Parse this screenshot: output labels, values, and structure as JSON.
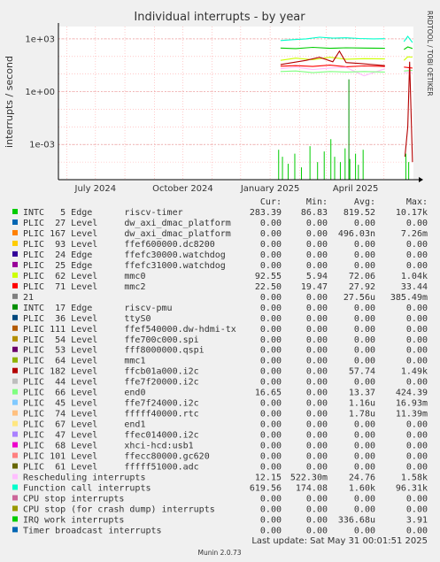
{
  "chart_data": {
    "type": "line",
    "title": "Individual interrupts - by year",
    "ylabel": "interrupts / second",
    "watermark": "RRDTOOL / TOBI OETIKER",
    "y_scale": "log",
    "ylim": [
      1e-05,
      5000
    ],
    "y_ticks": [
      {
        "value": 1000,
        "label": "1e+03"
      },
      {
        "value": 1,
        "label": "1e+00"
      },
      {
        "value": 0.001,
        "label": "1e-03"
      }
    ],
    "xlim": [
      "2024-05-23",
      "2025-06-01"
    ],
    "x_ticks": [
      {
        "date": "2024-07-01",
        "label": "July 2024"
      },
      {
        "date": "2024-10-01",
        "label": "October 2024"
      },
      {
        "date": "2025-01-01",
        "label": "January 2025"
      },
      {
        "date": "2025-04-01",
        "label": "April 2025"
      }
    ],
    "grid": true,
    "columns": [
      "Cur:",
      "Min:",
      "Avg:",
      "Max:"
    ],
    "series": [
      {
        "name": "INTC   5 Edge      riscv-timer",
        "color": "#00cc00",
        "cur": "283.39",
        "min": "86.83",
        "avg": "819.52",
        "max": "10.17k"
      },
      {
        "name": "PLIC  27 Level     dw_axi_dmac_platform",
        "color": "#0066b3",
        "cur": "0.00",
        "min": "0.00",
        "avg": "0.00",
        "max": "0.00"
      },
      {
        "name": "PLIC 167 Level     dw_axi_dmac_platform",
        "color": "#ff8000",
        "cur": "0.00",
        "min": "0.00",
        "avg": "496.03n",
        "max": "7.26m"
      },
      {
        "name": "PLIC  93 Level     ffef600000.dc8200",
        "color": "#ffcc00",
        "cur": "0.00",
        "min": "0.00",
        "avg": "0.00",
        "max": "0.00"
      },
      {
        "name": "PLIC  24 Edge      ffefc30000.watchdog",
        "color": "#330099",
        "cur": "0.00",
        "min": "0.00",
        "avg": "0.00",
        "max": "0.00"
      },
      {
        "name": "PLIC  25 Edge      ffefc31000.watchdog",
        "color": "#990099",
        "cur": "0.00",
        "min": "0.00",
        "avg": "0.00",
        "max": "0.00"
      },
      {
        "name": "PLIC  62 Level     mmc0",
        "color": "#ccff00",
        "cur": "92.55",
        "min": "5.94",
        "avg": "72.06",
        "max": "1.04k"
      },
      {
        "name": "PLIC  71 Level     mmc2",
        "color": "#ff0000",
        "cur": "22.50",
        "min": "19.47",
        "avg": "27.92",
        "max": "33.44"
      },
      {
        "name": "21",
        "color": "#808080",
        "cur": "0.00",
        "min": "0.00",
        "avg": "27.56u",
        "max": "385.49m"
      },
      {
        "name": "INTC  17 Edge      riscv-pmu",
        "color": "#008f00",
        "cur": "0.00",
        "min": "0.00",
        "avg": "0.00",
        "max": "0.00"
      },
      {
        "name": "PLIC  36 Level     ttyS0",
        "color": "#00487d",
        "cur": "0.00",
        "min": "0.00",
        "avg": "0.00",
        "max": "0.00"
      },
      {
        "name": "PLIC 111 Level     ffef540000.dw-hdmi-tx",
        "color": "#b35a00",
        "cur": "0.00",
        "min": "0.00",
        "avg": "0.00",
        "max": "0.00"
      },
      {
        "name": "PLIC  54 Level     ffe700c000.spi",
        "color": "#b38f00",
        "cur": "0.00",
        "min": "0.00",
        "avg": "0.00",
        "max": "0.00"
      },
      {
        "name": "PLIC  53 Level     fff8000000.qspi",
        "color": "#6b006b",
        "cur": "0.00",
        "min": "0.00",
        "avg": "0.00",
        "max": "0.00"
      },
      {
        "name": "PLIC  64 Level     mmc1",
        "color": "#8fb300",
        "cur": "0.00",
        "min": "0.00",
        "avg": "0.00",
        "max": "0.00"
      },
      {
        "name": "PLIC 182 Level     ffcb01a000.i2c",
        "color": "#b30000",
        "cur": "0.00",
        "min": "0.00",
        "avg": "57.74",
        "max": "1.49k"
      },
      {
        "name": "PLIC  44 Level     ffe7f20000.i2c",
        "color": "#bebebe",
        "cur": "0.00",
        "min": "0.00",
        "avg": "0.00",
        "max": "0.00"
      },
      {
        "name": "PLIC  66 Level     end0",
        "color": "#80ff80",
        "cur": "16.65",
        "min": "0.00",
        "avg": "13.37",
        "max": "424.39"
      },
      {
        "name": "PLIC  45 Level     ffe7f24000.i2c",
        "color": "#80c9ff",
        "cur": "0.00",
        "min": "0.00",
        "avg": "1.16u",
        "max": "16.93m"
      },
      {
        "name": "PLIC  74 Level     fffff40000.rtc",
        "color": "#ffc080",
        "cur": "0.00",
        "min": "0.00",
        "avg": "1.78u",
        "max": "11.39m"
      },
      {
        "name": "PLIC  67 Level     end1",
        "color": "#ffe680",
        "cur": "0.00",
        "min": "0.00",
        "avg": "0.00",
        "max": "0.00"
      },
      {
        "name": "PLIC  47 Level     ffec014000.i2c",
        "color": "#aa80ff",
        "cur": "0.00",
        "min": "0.00",
        "avg": "0.00",
        "max": "0.00"
      },
      {
        "name": "PLIC  68 Level     xhci-hcd:usb1",
        "color": "#ee00cc",
        "cur": "0.00",
        "min": "0.00",
        "avg": "0.00",
        "max": "0.00"
      },
      {
        "name": "PLIC 101 Level     ffecc80000.gc620",
        "color": "#ff8080",
        "cur": "0.00",
        "min": "0.00",
        "avg": "0.00",
        "max": "0.00"
      },
      {
        "name": "PLIC  61 Level     fffff51000.adc",
        "color": "#666600",
        "cur": "0.00",
        "min": "0.00",
        "avg": "0.00",
        "max": "0.00"
      },
      {
        "name": "Rescheduling interrupts",
        "color": "#ffbfff",
        "cur": "12.15",
        "min": "522.30m",
        "avg": "24.76",
        "max": "1.58k"
      },
      {
        "name": "Function call interrupts",
        "color": "#00ffcc",
        "cur": "619.56",
        "min": "174.08",
        "avg": "1.60k",
        "max": "96.31k"
      },
      {
        "name": "CPU stop interrupts",
        "color": "#cc6699",
        "cur": "0.00",
        "min": "0.00",
        "avg": "0.00",
        "max": "0.00"
      },
      {
        "name": "CPU stop (for crash dump) interrupts",
        "color": "#999900",
        "cur": "0.00",
        "min": "0.00",
        "avg": "0.00",
        "max": "0.00"
      },
      {
        "name": "IRQ work interrupts",
        "color": "#00cc00",
        "cur": "0.00",
        "min": "0.00",
        "avg": "336.68u",
        "max": "3.91"
      },
      {
        "name": "Timer broadcast interrupts",
        "color": "#0066b3",
        "cur": "0.00",
        "min": "0.00",
        "avg": "0.00",
        "max": "0.00"
      }
    ],
    "line_traces": [
      {
        "color": "#00ffcc",
        "segments": [
          [
            [
              "2025-01-12",
              800
            ],
            [
              "2025-01-25",
              900
            ],
            [
              "2025-02-08",
              1000
            ],
            [
              "2025-02-22",
              1250
            ],
            [
              "2025-03-08",
              1100
            ],
            [
              "2025-03-22",
              1150
            ],
            [
              "2025-04-05",
              1050
            ],
            [
              "2025-04-20",
              1000
            ],
            [
              "2025-05-02",
              1020
            ]
          ],
          [
            [
              "2025-05-22",
              700
            ],
            [
              "2025-05-26",
              1400
            ],
            [
              "2025-05-31",
              620
            ]
          ]
        ]
      },
      {
        "color": "#00cc00",
        "segments": [
          [
            [
              "2025-01-12",
              300
            ],
            [
              "2025-01-28",
              280
            ],
            [
              "2025-02-15",
              330
            ],
            [
              "2025-03-05",
              290
            ],
            [
              "2025-03-22",
              310
            ],
            [
              "2025-04-10",
              300
            ],
            [
              "2025-05-02",
              290
            ]
          ],
          [
            [
              "2025-05-22",
              250
            ],
            [
              "2025-05-26",
              350
            ],
            [
              "2025-05-31",
              283
            ]
          ]
        ]
      },
      {
        "color": "#ccff00",
        "segments": [
          [
            [
              "2025-01-12",
              60
            ],
            [
              "2025-01-28",
              80
            ],
            [
              "2025-02-15",
              65
            ],
            [
              "2025-03-05",
              90
            ],
            [
              "2025-03-22",
              70
            ],
            [
              "2025-04-10",
              75
            ],
            [
              "2025-05-02",
              72
            ]
          ],
          [
            [
              "2025-05-22",
              60
            ],
            [
              "2025-05-26",
              95
            ],
            [
              "2025-05-31",
              92
            ]
          ]
        ]
      },
      {
        "color": "#ff0000",
        "segments": [
          [
            [
              "2025-01-12",
              28
            ],
            [
              "2025-01-28",
              30
            ],
            [
              "2025-02-15",
              27
            ],
            [
              "2025-03-05",
              32
            ],
            [
              "2025-03-22",
              26
            ],
            [
              "2025-04-10",
              29
            ],
            [
              "2025-05-02",
              27
            ]
          ],
          [
            [
              "2025-05-22",
              25
            ],
            [
              "2025-05-31",
              22
            ]
          ]
        ]
      },
      {
        "color": "#ffbfff",
        "segments": [
          [
            [
              "2025-01-12",
              20
            ],
            [
              "2025-01-28",
              25
            ],
            [
              "2025-02-15",
              18
            ],
            [
              "2025-03-05",
              22
            ],
            [
              "2025-03-22",
              24
            ],
            [
              "2025-04-10",
              8
            ],
            [
              "2025-05-02",
              20
            ]
          ],
          [
            [
              "2025-05-22",
              12
            ],
            [
              "2025-05-31",
              12
            ]
          ]
        ]
      },
      {
        "color": "#80ff80",
        "segments": [
          [
            [
              "2025-01-12",
              14
            ],
            [
              "2025-01-28",
              15
            ],
            [
              "2025-02-15",
              12
            ],
            [
              "2025-03-05",
              14
            ],
            [
              "2025-03-22",
              13
            ],
            [
              "2025-04-10",
              14
            ],
            [
              "2025-05-02",
              13
            ]
          ],
          [
            [
              "2025-05-22",
              15
            ],
            [
              "2025-05-31",
              16
            ]
          ]
        ]
      },
      {
        "color": "#b30000",
        "segments": [
          [
            [
              "2025-01-12",
              35
            ],
            [
              "2025-02-08",
              60
            ],
            [
              "2025-02-22",
              90
            ],
            [
              "2025-03-08",
              50
            ],
            [
              "2025-03-15",
              200
            ],
            [
              "2025-03-22",
              45
            ],
            [
              "2025-04-05",
              40
            ],
            [
              "2025-05-02",
              30
            ]
          ],
          [
            [
              "2025-05-23",
              0.0002
            ],
            [
              "2025-05-26",
              0.01
            ],
            [
              "2025-05-28",
              50
            ],
            [
              "2025-05-31",
              0.0001
            ]
          ]
        ]
      }
    ],
    "spikes": [
      {
        "color": "#00cc00",
        "points": [
          [
            "2025-01-10",
            0.0005
          ],
          [
            "2025-01-14",
            0.0002
          ],
          [
            "2025-01-20",
            8e-05
          ],
          [
            "2025-01-27",
            0.0003
          ],
          [
            "2025-02-03",
            5e-05
          ],
          [
            "2025-02-12",
            0.0008
          ],
          [
            "2025-02-20",
            0.0001
          ],
          [
            "2025-02-27",
            0.0004
          ],
          [
            "2025-03-06",
            0.002
          ],
          [
            "2025-03-10",
            0.0002
          ],
          [
            "2025-03-16",
            0.0001
          ],
          [
            "2025-03-21",
            0.0006
          ],
          [
            "2025-03-26",
            0.00015
          ],
          [
            "2025-04-01",
            0.0003
          ],
          [
            "2025-04-04",
            7e-05
          ],
          [
            "2025-04-09",
            0.0005
          ],
          [
            "2025-05-24",
            0.0003
          ],
          [
            "2025-05-27",
            0.0001
          ]
        ]
      },
      {
        "color": "#008f00",
        "points": [
          [
            "2025-03-25",
            5
          ]
        ]
      }
    ],
    "footer": {
      "last_update": "Last update: Sat May 31 00:01:51 2025",
      "version": "Munin 2.0.73"
    }
  }
}
